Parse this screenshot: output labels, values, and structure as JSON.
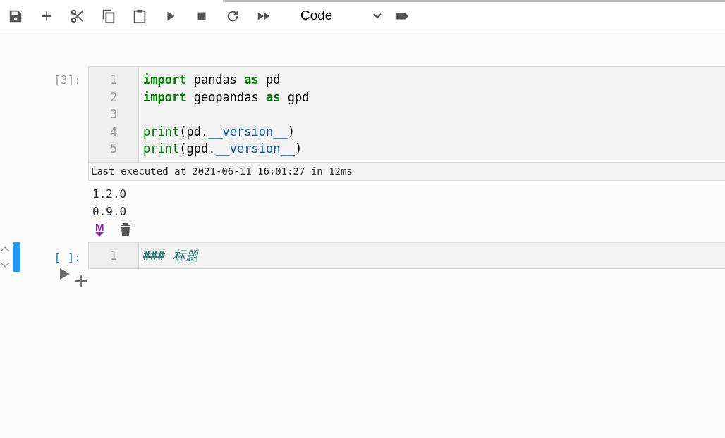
{
  "toolbar": {
    "buttons": [
      {
        "kind": "save"
      },
      {
        "kind": "add"
      },
      {
        "kind": "cut"
      },
      {
        "kind": "copy"
      },
      {
        "kind": "paste"
      },
      {
        "kind": "run"
      },
      {
        "kind": "stop"
      },
      {
        "kind": "restart"
      },
      {
        "kind": "run-all"
      }
    ],
    "cell_type": {
      "value": "Code"
    }
  },
  "cells": [
    {
      "prompt": "[3]:",
      "selected": false,
      "lines": [
        {
          "number": "1",
          "tokens": [
            {
              "kind": "keyword",
              "text": "import"
            },
            {
              "kind": "plain",
              "text": " pandas "
            },
            {
              "kind": "keyword",
              "text": "as"
            },
            {
              "kind": "plain",
              "text": " pd"
            }
          ]
        },
        {
          "number": "2",
          "tokens": [
            {
              "kind": "keyword",
              "text": "import"
            },
            {
              "kind": "plain",
              "text": " geopandas "
            },
            {
              "kind": "keyword",
              "text": "as"
            },
            {
              "kind": "plain",
              "text": " gpd"
            }
          ]
        },
        {
          "number": "3"
        },
        {
          "number": "4",
          "tokens": [
            {
              "kind": "builtin",
              "text": "print"
            },
            {
              "kind": "plain",
              "text": "(pd."
            },
            {
              "kind": "attr",
              "text": "__version__"
            },
            {
              "kind": "plain",
              "text": ")"
            }
          ]
        },
        {
          "number": "5",
          "tokens": [
            {
              "kind": "builtin",
              "text": "print"
            },
            {
              "kind": "plain",
              "text": "(gpd."
            },
            {
              "kind": "attr",
              "text": "__version__"
            },
            {
              "kind": "plain",
              "text": ")"
            }
          ]
        }
      ],
      "execution_info": "Last executed at 2021-06-11 16:01:27 in 12ms",
      "output": [
        "1.2.0",
        "0.9.0"
      ],
      "actions": [
        {
          "kind": "markdown",
          "label": "M"
        },
        {
          "kind": "delete"
        }
      ]
    },
    {
      "prompt": "[ ]:",
      "selected": true,
      "lines": [
        {
          "number": "1",
          "tokens": [
            {
              "kind": "heading-mark",
              "text": "###"
            },
            {
              "kind": "heading",
              "text": " 标题"
            }
          ]
        }
      ]
    }
  ]
}
